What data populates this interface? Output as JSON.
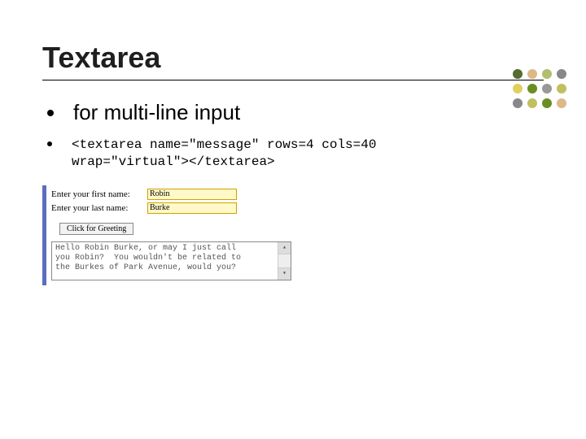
{
  "title": "Textarea",
  "bullets": {
    "main": "for multi-line input",
    "code": "<textarea name=\"message\" rows=4 cols=40\nwrap=\"virtual\"></textarea>"
  },
  "demo": {
    "firstname_label": "Enter your first name:",
    "firstname_value": "Robin",
    "lastname_label": "Enter your last name:",
    "lastname_value": "Burke",
    "button_label": "Click for Greeting",
    "textarea_value": "Hello Robin Burke, or may I just call\nyou Robin?  You wouldn't be related to\nthe Burkes of Park Avenue, would you?"
  },
  "dots": {
    "colors": [
      "#556b2f",
      "#deb887",
      "#b0c070",
      "#888888",
      "#e0d060",
      "#6b8e23",
      "#999999",
      "#c0c060",
      "#888888",
      "#c0c060",
      "#6b8e23",
      "#deb887"
    ]
  }
}
